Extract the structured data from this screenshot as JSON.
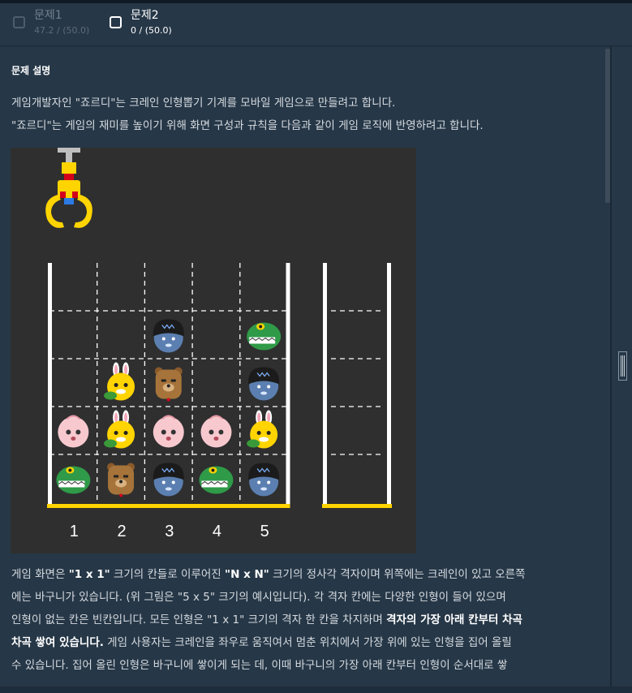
{
  "tabs": [
    {
      "title": "문제1",
      "score": "47.2 / (50.0)"
    },
    {
      "title": "문제2",
      "score": "0 / (50.0)"
    }
  ],
  "section_title": "문제 설명",
  "intro": {
    "line1": "게임개발자인 \"죠르디\"는 크레인 인형뽑기 기계를 모바일 게임으로 만들려고 합니다.",
    "line2": "\"죠르디\"는 게임의 재미를 높이기 위해 화면 구성과 규칙을 다음과 같이 게임 로직에 반영하려고 합니다."
  },
  "figure": {
    "column_numbers": [
      "1",
      "2",
      "3",
      "4",
      "5"
    ],
    "grid_rows": [
      [
        "",
        "",
        "",
        "",
        ""
      ],
      [
        "",
        "",
        "neo",
        "",
        "jordy"
      ],
      [
        "",
        "muzi",
        "frodo",
        "",
        "neo"
      ],
      [
        "apeach",
        "muzi",
        "apeach",
        "apeach",
        "muzi"
      ],
      [
        "jordy",
        "frodo",
        "neo",
        "jordy",
        "neo"
      ]
    ],
    "colors": {
      "background": "#2f2f2f",
      "frame": "#ffffff",
      "floor": "#ffd400",
      "crane": "#ffd400"
    }
  },
  "body": {
    "l1a": "게임 화면은 ",
    "l1b": "\"1 x 1\"",
    "l1c": " 크기의 칸들로 이루어진 ",
    "l1d": "\"N x N\"",
    "l1e": " 크기의 정사각 격자이며 위쪽에는 크레인이 있고 오른쪽",
    "l2": "에는 바구니가 있습니다. (위 그림은 \"5 x 5\" 크기의 예시입니다). 각 격자 칸에는 다양한 인형이 들어 있으며",
    "l3a": "인형이 없는 칸은 빈칸입니다. 모든 인형은 \"1 x 1\" 크기의 격자 한 칸을 차지하며 ",
    "l3b": "격자의 가장 아래 칸부터 차곡",
    "l4a": "차곡 쌓여 있습니다.",
    "l4b": " 게임 사용자는 크레인을 좌우로 움직여서 멈춘 위치에서 가장 위에 있는 인형을 집어 올릴",
    "l5": "수 있습니다. 집어 올린 인형은 바구니에 쌓이게 되는 데, 이때 바구니의 가장 아래 칸부터 인형이 순서대로 쌓"
  }
}
